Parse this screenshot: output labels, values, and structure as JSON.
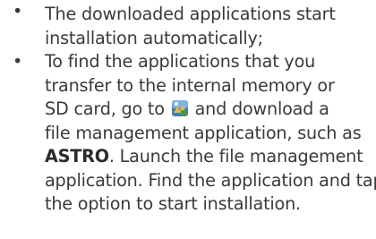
{
  "items": [
    {
      "bullet": "•",
      "lines": [
        "The downloaded applications start",
        "installation automatically;"
      ]
    },
    {
      "bullet": "•",
      "lines": [
        "To find the applications that you",
        "transfer to the internal memory or"
      ],
      "line3_before_icon": "SD card, go to",
      "line3_after_icon": " and download a",
      "icon_name": "market-app-icon",
      "line4": "file management application, such as",
      "line5_strong": "ASTRO",
      "line5_rest": ". Launch the file management",
      "line6": "application. Find the application and tap",
      "line7": "the option to start installation."
    }
  ]
}
